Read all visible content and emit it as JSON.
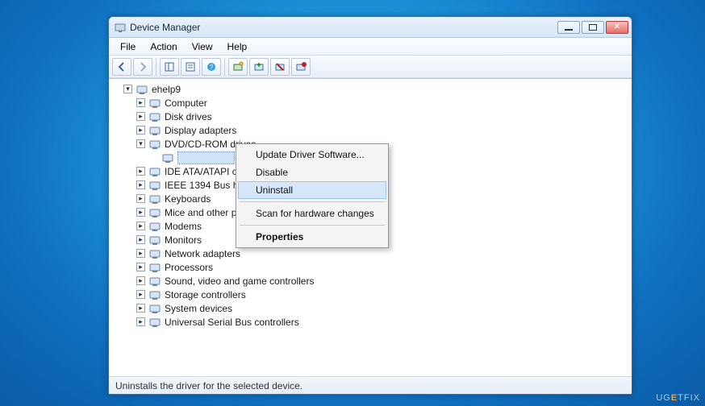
{
  "window": {
    "title": "Device Manager"
  },
  "menubar": {
    "items": [
      "File",
      "Action",
      "View",
      "Help"
    ]
  },
  "tree": {
    "root": "ehelp9",
    "nodes": [
      {
        "label": "Computer",
        "expandable": true
      },
      {
        "label": "Disk drives",
        "expandable": true
      },
      {
        "label": "Display adapters",
        "expandable": true
      },
      {
        "label": "DVD/CD-ROM drives",
        "expandable": true,
        "expanded": true,
        "children": [
          {
            "label": "",
            "selected": true
          }
        ]
      },
      {
        "label": "IDE ATA/ATAPI controll",
        "expandable": true
      },
      {
        "label": "IEEE 1394 Bus host contr",
        "expandable": true
      },
      {
        "label": "Keyboards",
        "expandable": true
      },
      {
        "label": "Mice and other pointing",
        "expandable": true
      },
      {
        "label": "Modems",
        "expandable": true
      },
      {
        "label": "Monitors",
        "expandable": true
      },
      {
        "label": "Network adapters",
        "expandable": true
      },
      {
        "label": "Processors",
        "expandable": true
      },
      {
        "label": "Sound, video and game controllers",
        "expandable": true
      },
      {
        "label": "Storage controllers",
        "expandable": true
      },
      {
        "label": "System devices",
        "expandable": true
      },
      {
        "label": "Universal Serial Bus controllers",
        "expandable": true
      }
    ]
  },
  "context_menu": {
    "items": [
      {
        "label": "Update Driver Software...",
        "type": "item"
      },
      {
        "label": "Disable",
        "type": "item"
      },
      {
        "label": "Uninstall",
        "type": "item",
        "highlighted": true
      },
      {
        "type": "sep"
      },
      {
        "label": "Scan for hardware changes",
        "type": "item"
      },
      {
        "type": "sep"
      },
      {
        "label": "Properties",
        "type": "item",
        "bold": true
      }
    ]
  },
  "statusbar": {
    "text": "Uninstalls the driver for the selected device."
  },
  "watermark": {
    "prefix": "UG",
    "accent": "E",
    "suffix": "TFIX"
  }
}
